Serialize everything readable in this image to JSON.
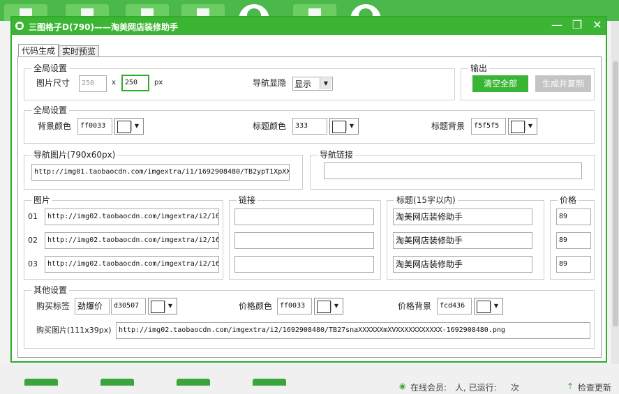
{
  "window": {
    "title": "三图格子D(790)——淘美网店装修助手",
    "min_glyph": "—",
    "max_glyph": "❐",
    "close_glyph": "✕"
  },
  "tabs": [
    "代码生成",
    "实时预览"
  ],
  "global1": {
    "legend": "全局设置",
    "size_label": "图片尺寸",
    "width_value": "250",
    "times": "x",
    "height_value": "250",
    "unit": "px",
    "nav_label": "导航显隐",
    "nav_value": "显示"
  },
  "output": {
    "legend": "输出",
    "clear_label": "清空全部",
    "generate_label": "生成并复制"
  },
  "global2": {
    "legend": "全局设置",
    "bg_label": "背景颜色",
    "bg_value": "ff0033",
    "title_color_label": "标题颜色",
    "title_color_value": "333",
    "title_bg_label": "标题背景",
    "title_bg_value": "f5f5f5"
  },
  "nav_image": {
    "legend": "导航图片(790x60px)",
    "value": "http://img01.taobaocdn.com/imgextra/i1/1692908480/TB2ypT1XpXX"
  },
  "nav_link": {
    "legend": "导航链接",
    "value": ""
  },
  "pictures": {
    "legend": "图片",
    "rows": [
      {
        "index": "01",
        "url": "http://img02.taobaocdn.com/imgextra/i2/16"
      },
      {
        "index": "02",
        "url": "http://img02.taobaocdn.com/imgextra/i2/16"
      },
      {
        "index": "03",
        "url": "http://img02.taobaocdn.com/imgextra/i2/16"
      }
    ]
  },
  "links": {
    "legend": "链接",
    "values": [
      "",
      "",
      ""
    ]
  },
  "titles": {
    "legend": "标题(15字以内)",
    "values": [
      "淘美网店装修助手",
      "淘美网店装修助手",
      "淘美网店装修助手"
    ]
  },
  "prices": {
    "legend": "价格",
    "values": [
      "89",
      "89",
      "89"
    ]
  },
  "other": {
    "legend": "其他设置",
    "buy_tag_label": "购买标签",
    "buy_tag_value": "劲爆价",
    "buy_tag_color": "d30507",
    "price_color_label": "价格颜色",
    "price_color_value": "ff0033",
    "price_bg_label": "价格背景",
    "price_bg_value": "fcd436",
    "buy_image_label": "购买图片(111x39px)",
    "buy_image_value": "http://img02.taobaocdn.com/imgextra/i2/1692908480/TB27snaXXXXXXmXVXXXXXXXXXXX-1692908480.png"
  },
  "status": {
    "online_label": "在线会员:",
    "online_suffix": "人, 已运行:",
    "runs_suffix": "次",
    "update_label": "检查更新"
  }
}
